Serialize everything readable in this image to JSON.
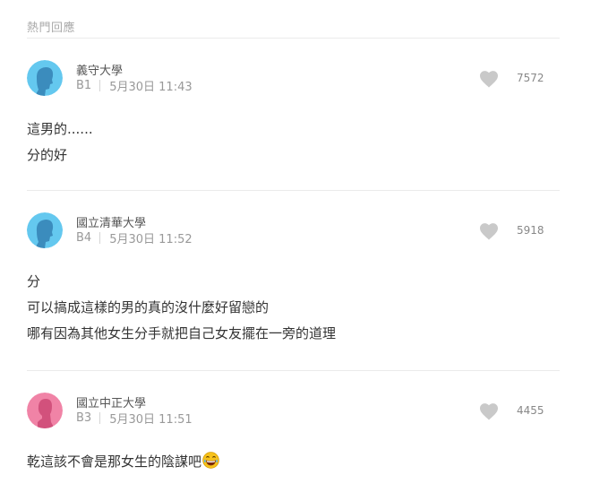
{
  "section": {
    "title": "熱門回應"
  },
  "colors": {
    "male_avatar": "#64c8ef",
    "male_figure": "#3b8cbd",
    "female_avatar": "#f083a6",
    "female_figure": "#d2517c",
    "heart": "#c9c9c9"
  },
  "comments": [
    {
      "school": "義守大學",
      "floor": "B1",
      "time": "5月30日 11:43",
      "likes": "7572",
      "avatar": "male-avatar-icon",
      "lines": [
        "這男的......",
        "分的好"
      ]
    },
    {
      "school": "國立清華大學",
      "floor": "B4",
      "time": "5月30日 11:52",
      "likes": "5918",
      "avatar": "male-avatar-icon",
      "lines": [
        "分",
        "可以搞成這樣的男的真的沒什麼好留戀的",
        "哪有因為其他女生分手就把自己女友擺在一旁的道理"
      ]
    },
    {
      "school": "國立中正大學",
      "floor": "B3",
      "time": "5月30日 11:51",
      "likes": "4455",
      "avatar": "female-avatar-icon",
      "lines": [
        "乾這該不會是那女生的陰謀吧"
      ],
      "emoji": "grinning-sweat-emoji"
    }
  ]
}
